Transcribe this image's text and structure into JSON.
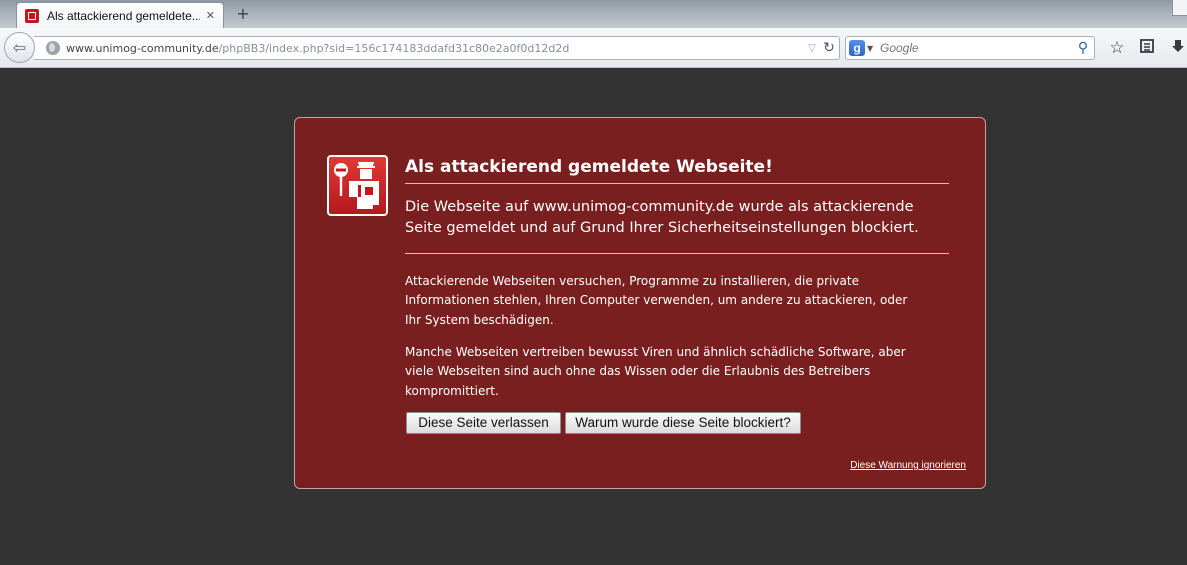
{
  "browser": {
    "tab_title": "Als attackierend gemeldete...",
    "tab_close": "✕",
    "new_tab": "+",
    "url_host": "www.unimog-community.de",
    "url_path": "/phpBB3/index.php?sid=156c174183ddafd31c80e2a0f0d12d2d",
    "search_placeholder": "Google",
    "search_engine_letter": "g",
    "icons": {
      "back": "back-arrow-icon",
      "site": "globe-icon",
      "history": "dropdown-arrow-icon",
      "reload": "reload-icon",
      "search": "magnifier-icon",
      "bookmark": "star-icon",
      "bookmarks_list": "bookmarks-list-icon",
      "downloads": "download-arrow-icon"
    }
  },
  "warning": {
    "title": "Als attackierend gemeldete Webseite!",
    "subtitle": "Die Webseite auf www.unimog-community.de wurde als attackierende Seite gemeldet und auf Grund Ihrer Sicherheitseinstellungen blockiert.",
    "paragraph1": "Attackierende Webseiten versuchen, Programme zu installieren, die private Informationen stehlen, Ihren Computer verwenden, um andere zu attackieren, oder Ihr System beschädigen.",
    "paragraph2": "Manche Webseiten vertreiben bewusst Viren und ähnlich schädliche Software, aber viele Webseiten sind auch ohne das Wissen oder die Erlaubnis des Betreibers kompromittiert.",
    "leave_button": "Diese Seite verlassen",
    "why_button": "Warum wurde diese Seite blockiert?",
    "ignore_link": "Diese Warnung ignorieren",
    "icon": "police-officer-stop-icon"
  },
  "colors": {
    "page_background": "#333333",
    "error_background": "#7a1f1f",
    "icon_red": "#c4161c"
  }
}
